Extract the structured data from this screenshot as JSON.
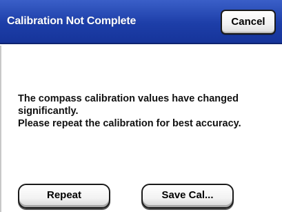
{
  "dialog": {
    "title": "Calibration Not Complete",
    "cancel_label": "Cancel",
    "message_lines": [
      "The compass calibration values have changed",
      "significantly.",
      "Please repeat the calibration for best accuracy."
    ],
    "buttons": {
      "repeat_label": "Repeat",
      "save_cal_label": "Save Cal..."
    }
  },
  "colors": {
    "titlebar": "#1d3ea8",
    "title_text": "#ffffff",
    "background": "#ffffff",
    "button_border": "#1a1a1a"
  }
}
